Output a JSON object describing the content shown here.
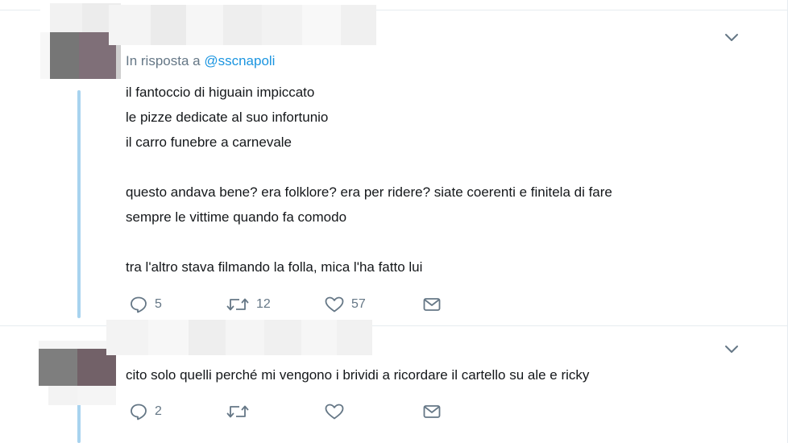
{
  "tweets": [
    {
      "reply_to_prefix": "In risposta a ",
      "reply_to_handle": "@sscnapoli",
      "body": "il fantoccio di higuain impiccato\nle pizze dedicate al suo infortunio\nil carro funebre a carnevale\n\nquesto andava bene? era folklore? era per ridere? siate coerenti e finitela di fare\nsempre le vittime quando fa comodo\n\ntra l'altro stava filmando la folla, mica l'ha fatto lui",
      "actions": {
        "reply_count": "5",
        "retweet_count": "12",
        "like_count": "57"
      },
      "icons": [
        "reply-icon",
        "retweet-icon",
        "like-icon",
        "message-icon",
        "chevron-down-icon"
      ]
    },
    {
      "body": "cito solo quelli perché mi vengono i brividi a ricordare il cartello su ale e ricky",
      "actions": {
        "reply_count": "2",
        "retweet_count": "",
        "like_count": ""
      },
      "icons": [
        "reply-icon",
        "retweet-icon",
        "like-icon",
        "message-icon",
        "chevron-down-icon"
      ]
    }
  ],
  "colors": {
    "text": "#14171a",
    "secondary": "#657786",
    "link": "#1b95e0",
    "thread_line": "#a8d3ef",
    "divider": "#e6ecf0"
  }
}
